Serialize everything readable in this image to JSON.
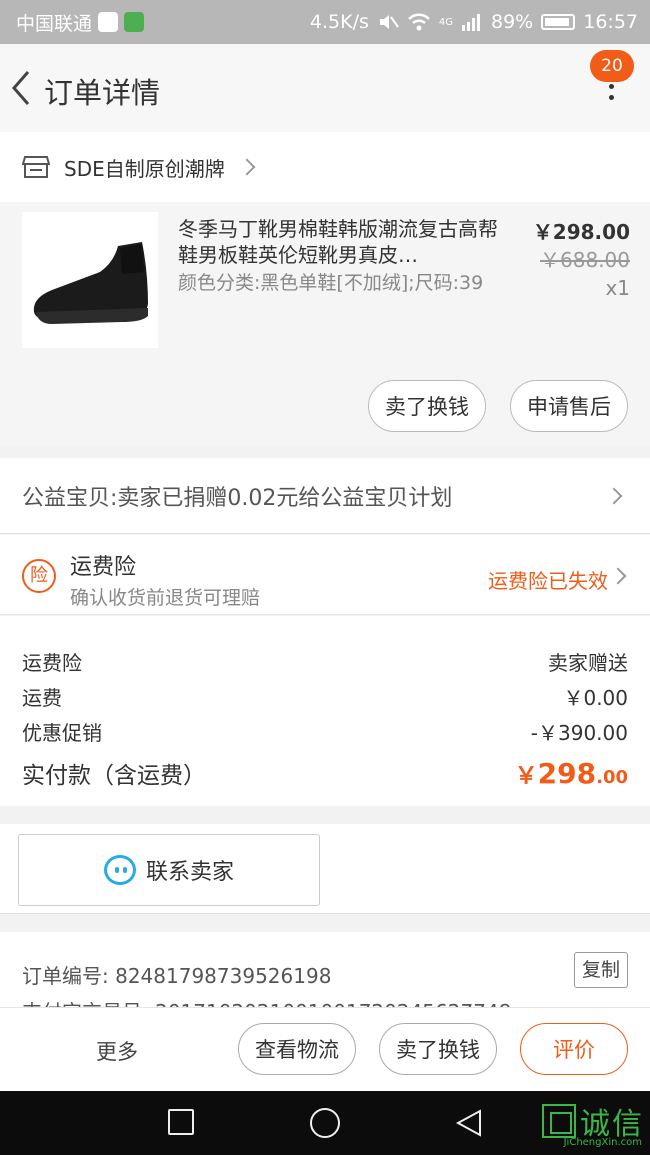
{
  "status_bar": {
    "carrier": "中国联通",
    "speed": "4.5K/s",
    "network": "4G",
    "battery": "89%",
    "time": "16:57"
  },
  "header": {
    "title": "订单详情",
    "badge_count": "20"
  },
  "shop": {
    "name": "SDE自制原创潮牌"
  },
  "item": {
    "title": "冬季马丁靴男棉鞋韩版潮流复古高帮鞋男板鞋英伦短靴男真皮…",
    "sku": "颜色分类:黑色单鞋[不加绒];尺码:39",
    "price": "￥298.00",
    "original_price": "￥688.00",
    "quantity": "x1",
    "actions": [
      "卖了换钱",
      "申请售后"
    ]
  },
  "charity": {
    "text": "公益宝贝:卖家已捐赠0.02元给公益宝贝计划"
  },
  "insurance": {
    "icon_char": "险",
    "title": "运费险",
    "subtitle": "确认收货前退货可理赔",
    "status": "运费险已失效"
  },
  "summary": {
    "rows": [
      {
        "label": "运费险",
        "value": "卖家赠送"
      },
      {
        "label": "运费",
        "value": "￥0.00"
      },
      {
        "label": "优惠促销",
        "value": "-￥390.00"
      }
    ],
    "total_label": "实付款（含运费）",
    "total_currency": "￥",
    "total_integer": "298",
    "total_decimal": ".00"
  },
  "contact": {
    "label": "联系卖家"
  },
  "order_info": {
    "order_number": "订单编号: 824817987395261​98",
    "payment_number": "支付宝交易号: 201710202100100172024562774​8",
    "copy_label": "复制"
  },
  "action_bar": {
    "more": "更多",
    "logistics": "查看物流",
    "sell": "卖了换钱",
    "review": "评价"
  },
  "watermark": {
    "text": "诚信",
    "sub": "JiChengXin.com"
  },
  "colors": {
    "accent": "#f25c19",
    "contact_icon": "#29a9e8",
    "watermark": "#3cb54a"
  }
}
